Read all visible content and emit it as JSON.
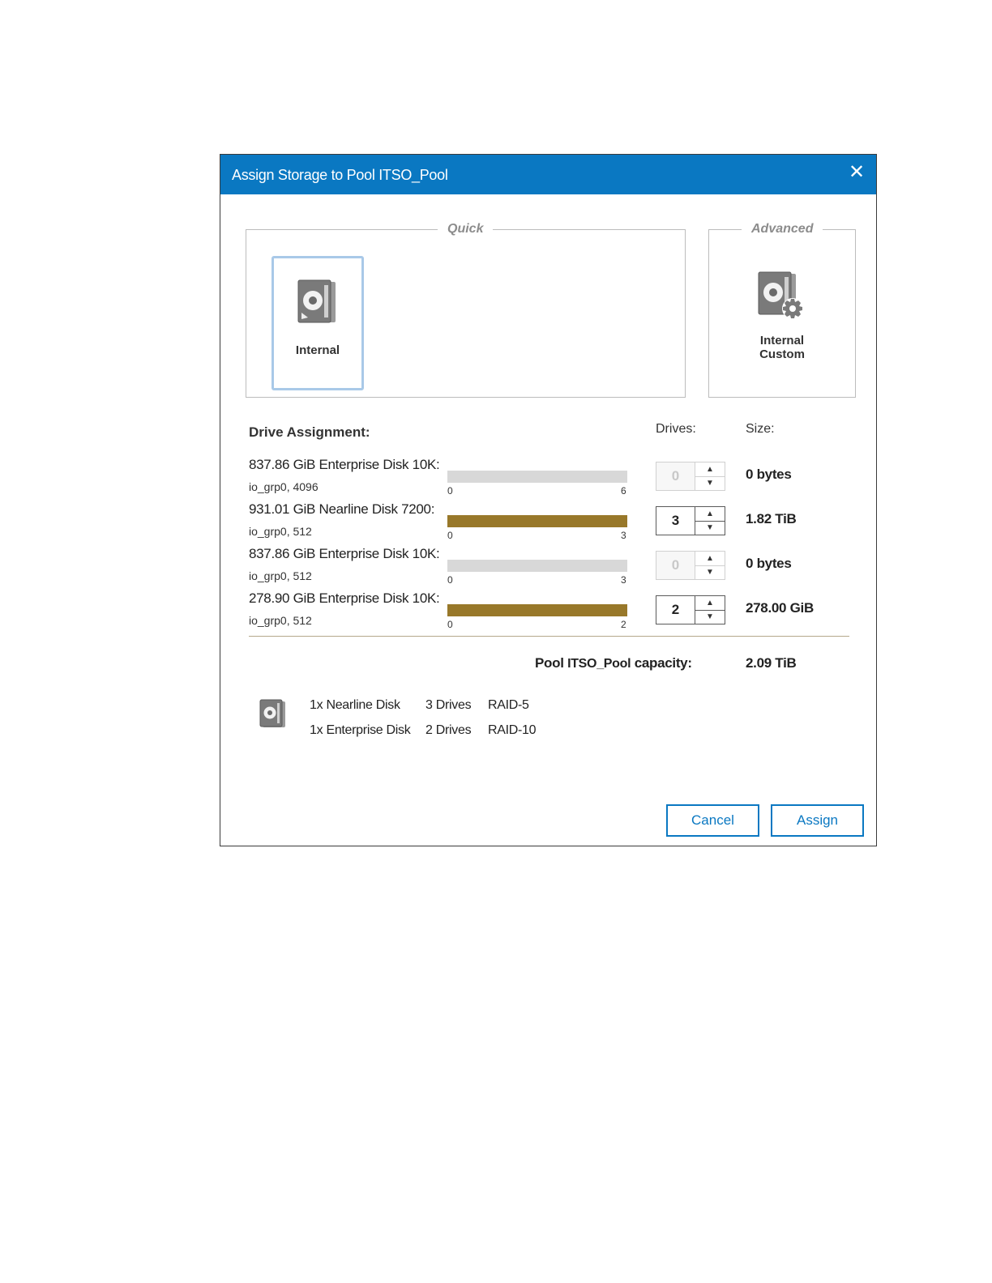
{
  "dialog": {
    "title": "Assign Storage to Pool ITSO_Pool",
    "close_icon": "close-icon",
    "accent_color": "#0a78c2"
  },
  "quick": {
    "legend": "Quick",
    "tiles": [
      {
        "label": "Internal",
        "icon": "hard-disk-icon",
        "selected": true
      }
    ]
  },
  "advanced": {
    "legend": "Advanced",
    "tiles": [
      {
        "label_line1": "Internal",
        "label_line2": "Custom",
        "icon": "hard-disk-gear-icon"
      }
    ]
  },
  "drive_assignment": {
    "label": "Drive Assignment:",
    "drives_header": "Drives:",
    "size_header": "Size:",
    "fill_color": "#98782a",
    "rows": [
      {
        "name": "837.86 GiB Enterprise Disk 10K:",
        "sub": "io_grp0, 4096",
        "min": "0",
        "max": "6",
        "drives": "0",
        "size": "0 bytes",
        "fill": 0,
        "disabled": true
      },
      {
        "name": "931.01 GiB Nearline Disk 7200:",
        "sub": "io_grp0, 512",
        "min": "0",
        "max": "3",
        "drives": "3",
        "size": "1.82 TiB",
        "fill": 1,
        "disabled": false
      },
      {
        "name": "837.86 GiB Enterprise Disk 10K:",
        "sub": "io_grp0, 512",
        "min": "0",
        "max": "3",
        "drives": "0",
        "size": "0 bytes",
        "fill": 0,
        "disabled": true
      },
      {
        "name": "278.90 GiB Enterprise Disk 10K:",
        "sub": "io_grp0, 512",
        "min": "0",
        "max": "2",
        "drives": "2",
        "size": "278.00 GiB",
        "fill": 1,
        "disabled": false
      }
    ]
  },
  "capacity": {
    "label_prefix": "Pool ",
    "pool_name": "ITSO_Pool",
    "label_suffix": " capacity:",
    "value": "2.09 TiB"
  },
  "summary": [
    {
      "disk": "1x Nearline Disk",
      "drives": "3 Drives",
      "raid": "RAID-5"
    },
    {
      "disk": "1x Enterprise Disk",
      "drives": "2 Drives",
      "raid": "RAID-10"
    }
  ],
  "buttons": {
    "cancel": "Cancel",
    "assign": "Assign"
  }
}
